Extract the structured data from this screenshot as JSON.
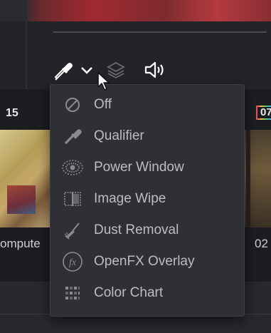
{
  "toolbar": {
    "tools": [
      "eyedropper-icon",
      "chevron-down-icon",
      "layers-icon",
      "speaker-icon"
    ]
  },
  "timeline": {
    "clip_left_number": "15",
    "clip_right_number": "07",
    "clip_left_label": "ompute",
    "clip_right_label": "02"
  },
  "menu": {
    "items": [
      {
        "label": "Off",
        "icon": "off-icon"
      },
      {
        "label": "Qualifier",
        "icon": "qualifier-eyedropper-icon"
      },
      {
        "label": "Power Window",
        "icon": "power-window-icon"
      },
      {
        "label": "Image Wipe",
        "icon": "image-wipe-icon"
      },
      {
        "label": "Dust Removal",
        "icon": "brush-icon"
      },
      {
        "label": "OpenFX Overlay",
        "icon": "fx-icon"
      },
      {
        "label": "Color Chart",
        "icon": "color-chart-icon"
      }
    ]
  },
  "colors": {
    "menu_bg": "#2f3035",
    "menu_text": "#bdbdc1",
    "icon": "#8a8b90"
  }
}
